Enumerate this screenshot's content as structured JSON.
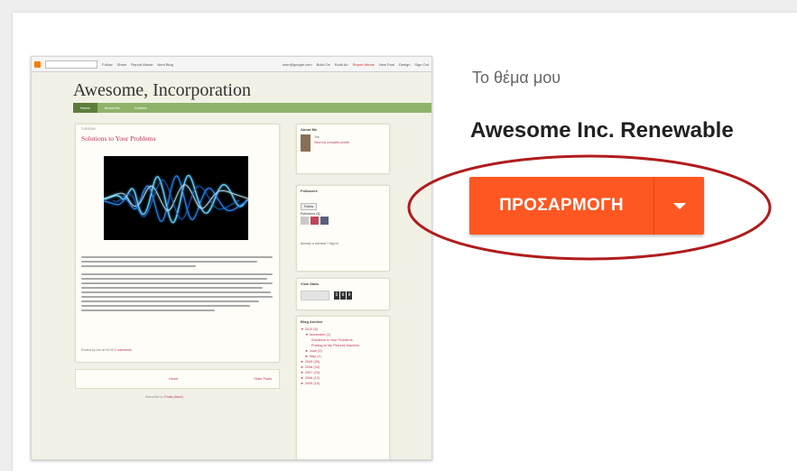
{
  "preview": {
    "navbar": {
      "links": [
        "Follow",
        "Share",
        "Report Abuse",
        "Next Blog"
      ],
      "right": [
        "user@google.com",
        "Build On",
        "Build An"
      ],
      "report": "Report Abuse",
      "right2": [
        "New Post",
        "Design",
        "Sign Out"
      ]
    },
    "blog_title": "Awesome, Incorporation",
    "tabs": [
      "Home",
      "About Me",
      "Contact"
    ],
    "post": {
      "date": "TUESDAY",
      "title": "Solutions to Your Problems",
      "footer_prefix": "Posted by Joe at 00:00",
      "footer_link": "3 comments"
    },
    "pager": {
      "home": "Home",
      "older": "Older Posts"
    },
    "subscribe": {
      "prefix": "Subscribe to:",
      "link": "Posts (Atom)"
    },
    "widgets": {
      "about": {
        "title": "About Me",
        "name": "Joe",
        "link": "View my complete profile"
      },
      "followers": {
        "title": "Followers",
        "follow": "Follow",
        "count": "Followers (3)",
        "footer": "Already a member? Sign in"
      },
      "stats": {
        "title": "View Stats",
        "digits": [
          "5",
          "8",
          "9"
        ]
      },
      "archive": {
        "title": "Blog Archive",
        "items": [
          "▼ 2010 (5)",
          "▼ November (2)",
          "Solutions to Your Problems",
          "Posting to My Pictures Machine",
          "► June (2)",
          "► May (1)",
          "► 2009 (35)",
          "► 2008 (34)",
          "► 2007 (24)",
          "► 2006 (12)",
          "► 2005 (10)"
        ]
      }
    }
  },
  "theme_section": {
    "label": "Το θέμα μου",
    "theme_name": "Awesome Inc. Renewable",
    "customize_label": "ΠΡΟΣΑΡΜΟΓΗ"
  },
  "icons": {
    "dropdown": "chevron-down-icon"
  },
  "colors": {
    "accent": "#ff5722",
    "highlight": "#b01c1c"
  }
}
